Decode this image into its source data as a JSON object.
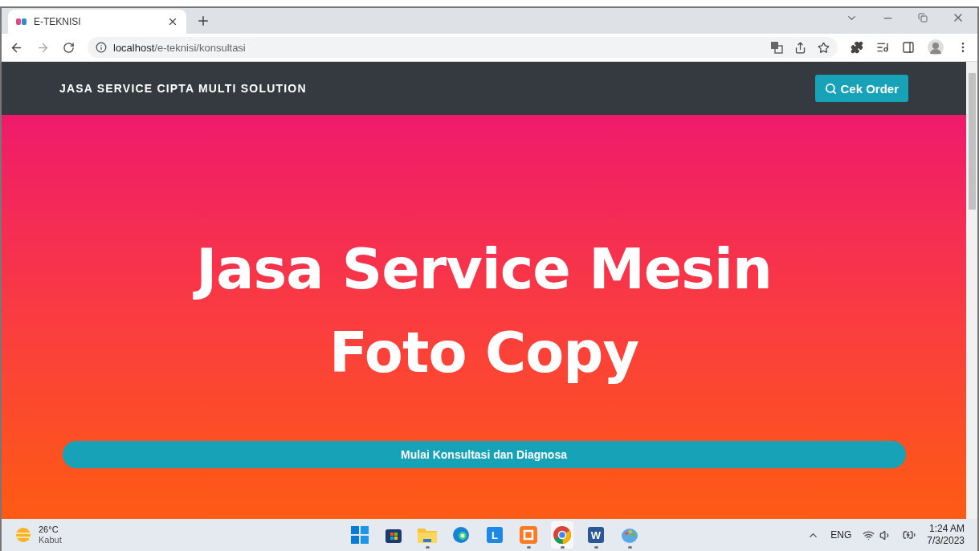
{
  "browser": {
    "tab": {
      "title": "E-TEKNISI",
      "selected": true
    },
    "url_host": "localhost",
    "url_path": "/e-teknisi/konsultasi"
  },
  "navbar": {
    "brand": "JASA SERVICE CIPTA MULTI SOLUTION",
    "button": "Cek Order"
  },
  "hero": {
    "title_lines": [
      "Jasa Service Mesin",
      "Foto Copy"
    ],
    "button": "Mulai Konsultasi dan Diagnosa"
  },
  "taskbar": {
    "weather": {
      "temp": "26°C",
      "condition": "Kabut"
    },
    "apps": [
      {
        "kind": "windows",
        "active": false
      },
      {
        "kind": "store",
        "active": false
      },
      {
        "kind": "folder",
        "active": true
      },
      {
        "kind": "edge",
        "active": false
      },
      {
        "kind": "letter",
        "label": "L",
        "color": "#1e88e5",
        "active": false
      },
      {
        "kind": "xampp",
        "active": true
      },
      {
        "kind": "chrome",
        "active": true
      },
      {
        "kind": "letter",
        "label": "W",
        "color": "#2b5797",
        "active": true
      },
      {
        "kind": "paint",
        "active": true
      }
    ],
    "language": "ENG",
    "time": "1:24 AM",
    "date": "7/3/2023"
  }
}
